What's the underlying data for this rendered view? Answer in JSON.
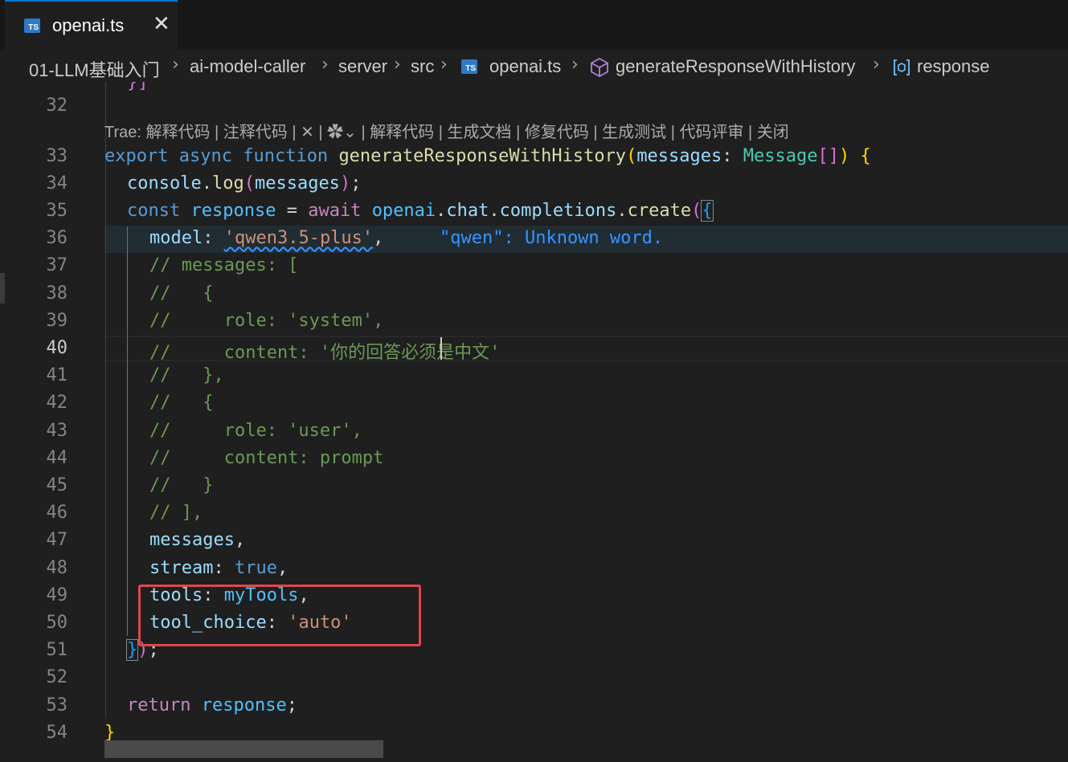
{
  "tab": {
    "file_label": "openai.ts",
    "file_badge": "TS",
    "close_glyph": "✕"
  },
  "breadcrumb": {
    "items": [
      "01-LLM基础入门",
      "ai-model-caller",
      "server",
      "src",
      "openai.ts",
      "generateResponseWithHistory",
      "response"
    ],
    "separator": "›"
  },
  "codelens": {
    "text": "Trae: 解释代码 | 注释代码 | ✕ | ✿⌄ | 解释代码 | 生成文档 | 修复代码 | 生成测试 | 代码评审 | 关闭"
  },
  "editor": {
    "line_numbers": [
      "32",
      "33",
      "34",
      "35",
      "36",
      "37",
      "38",
      "39",
      "40",
      "41",
      "42",
      "43",
      "44",
      "45",
      "46",
      "47",
      "48",
      "49",
      "50",
      "51",
      "52",
      "53",
      "54"
    ],
    "active_line": "40",
    "code": {
      "l31": "}]",
      "l33_export": "export",
      "l33_async": "async",
      "l33_function": "function",
      "l33_name": "generateResponseWithHistory",
      "l33_param": "messages",
      "l33_type": "Message",
      "l34_console": "console",
      "l34_log": "log",
      "l34_arg": "messages",
      "l35_const": "const",
      "l35_response": "response",
      "l35_await": "await",
      "l35_openai": "openai",
      "l35_chat": "chat",
      "l35_completions": "completions",
      "l35_create": "create",
      "l36_model": "model",
      "l36_value": "'qwen3.5-plus'",
      "l36_diag": "\"qwen\": Unknown word.",
      "l37": "// messages: [",
      "l38": "//   {",
      "l39": "//     role: 'system',",
      "l40": "//     content: '你的回答必须是中文'",
      "l41": "//   },",
      "l42": "//   {",
      "l43": "//     role: 'user',",
      "l44": "//     content: prompt",
      "l45": "//   }",
      "l46": "// ],",
      "l47": "messages",
      "l48_key": "stream",
      "l48_val": "true",
      "l49_key": "tools",
      "l49_val": "myTools",
      "l50_key": "tool_choice",
      "l50_val": "'auto'",
      "l53_return": "return",
      "l53_val": "response"
    }
  },
  "colors": {
    "background": "#1f1f1f",
    "highlight_box": "#e0464b",
    "keyword": "#569cd6",
    "string": "#ce9178",
    "comment": "#6a9955",
    "function": "#dcdcaa",
    "variable": "#9cdcfe"
  },
  "icons": [
    "typescript-file-icon",
    "close-icon",
    "chevron-right-icon",
    "symbol-method-icon",
    "symbol-variable-icon"
  ]
}
